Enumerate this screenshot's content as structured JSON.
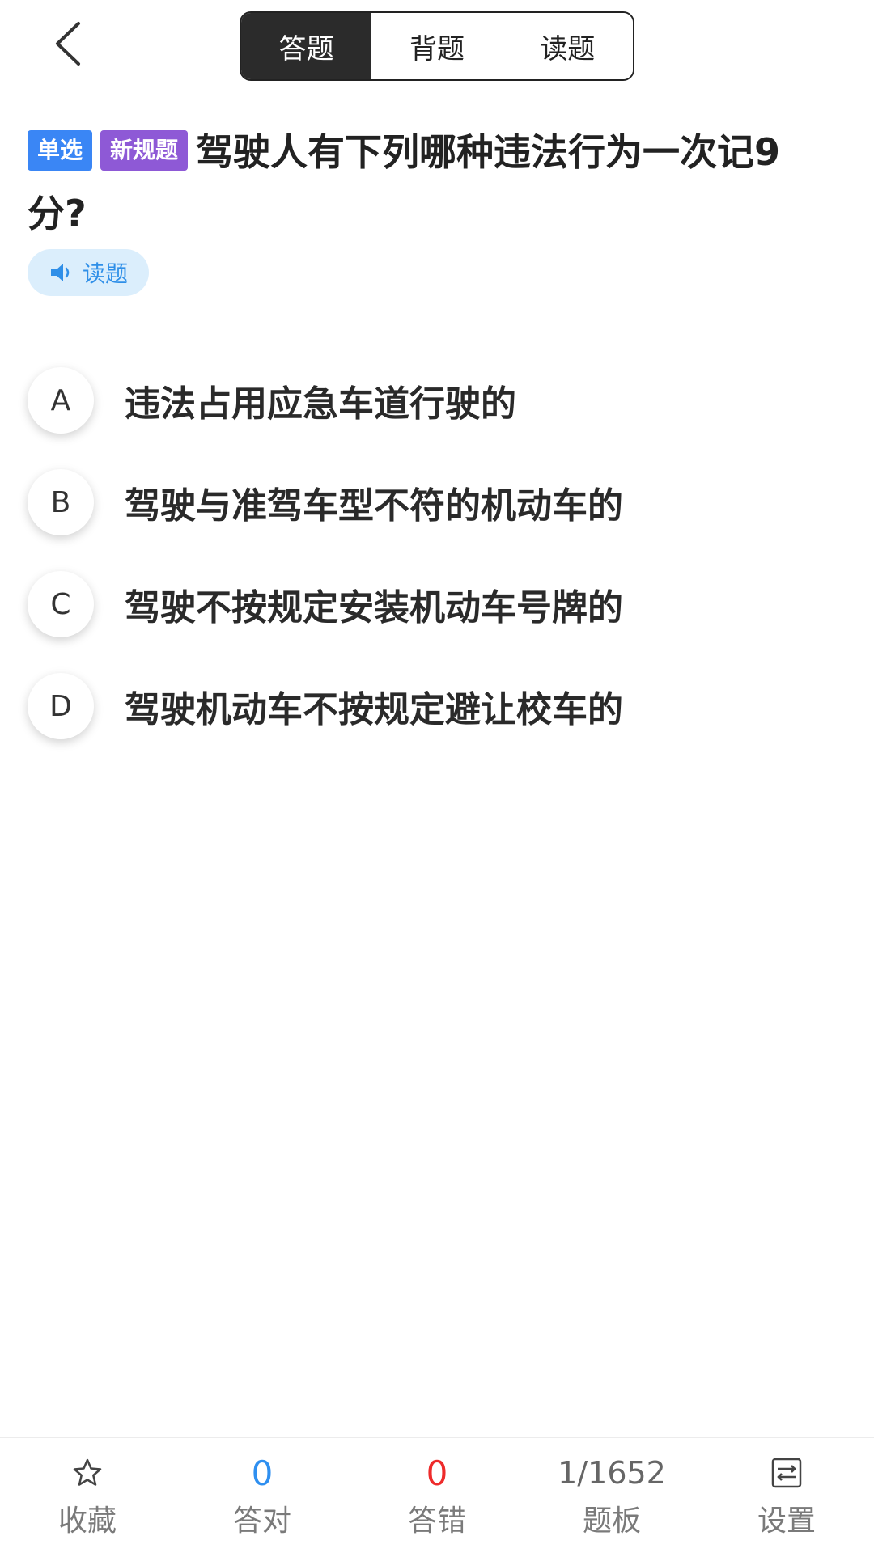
{
  "header": {
    "tabs": [
      {
        "label": "答题",
        "active": true
      },
      {
        "label": "背题",
        "active": false
      },
      {
        "label": "读题",
        "active": false
      }
    ],
    "back_icon": "chevron-left-icon"
  },
  "question": {
    "tags": [
      "单选",
      "新规题"
    ],
    "text": "驾驶人有下列哪种违法行为一次记9分?",
    "read_label": "读题"
  },
  "options": [
    {
      "key": "A",
      "text": "违法占用应急车道行驶的"
    },
    {
      "key": "B",
      "text": "驾驶与准驾车型不符的机动车的"
    },
    {
      "key": "C",
      "text": "驾驶不按规定安装机动车号牌的"
    },
    {
      "key": "D",
      "text": "驾驶机动车不按规定避让校车的"
    }
  ],
  "bottom_bar": {
    "favorite_label": "收藏",
    "correct_count": "0",
    "correct_label": "答对",
    "wrong_count": "0",
    "wrong_label": "答错",
    "progress": "1/1652",
    "board_label": "题板",
    "settings_label": "设置"
  },
  "colors": {
    "tag_single": "#3a86f5",
    "tag_new": "#8e59d6",
    "correct": "#2e8ff0",
    "wrong": "#ee2b2b"
  }
}
